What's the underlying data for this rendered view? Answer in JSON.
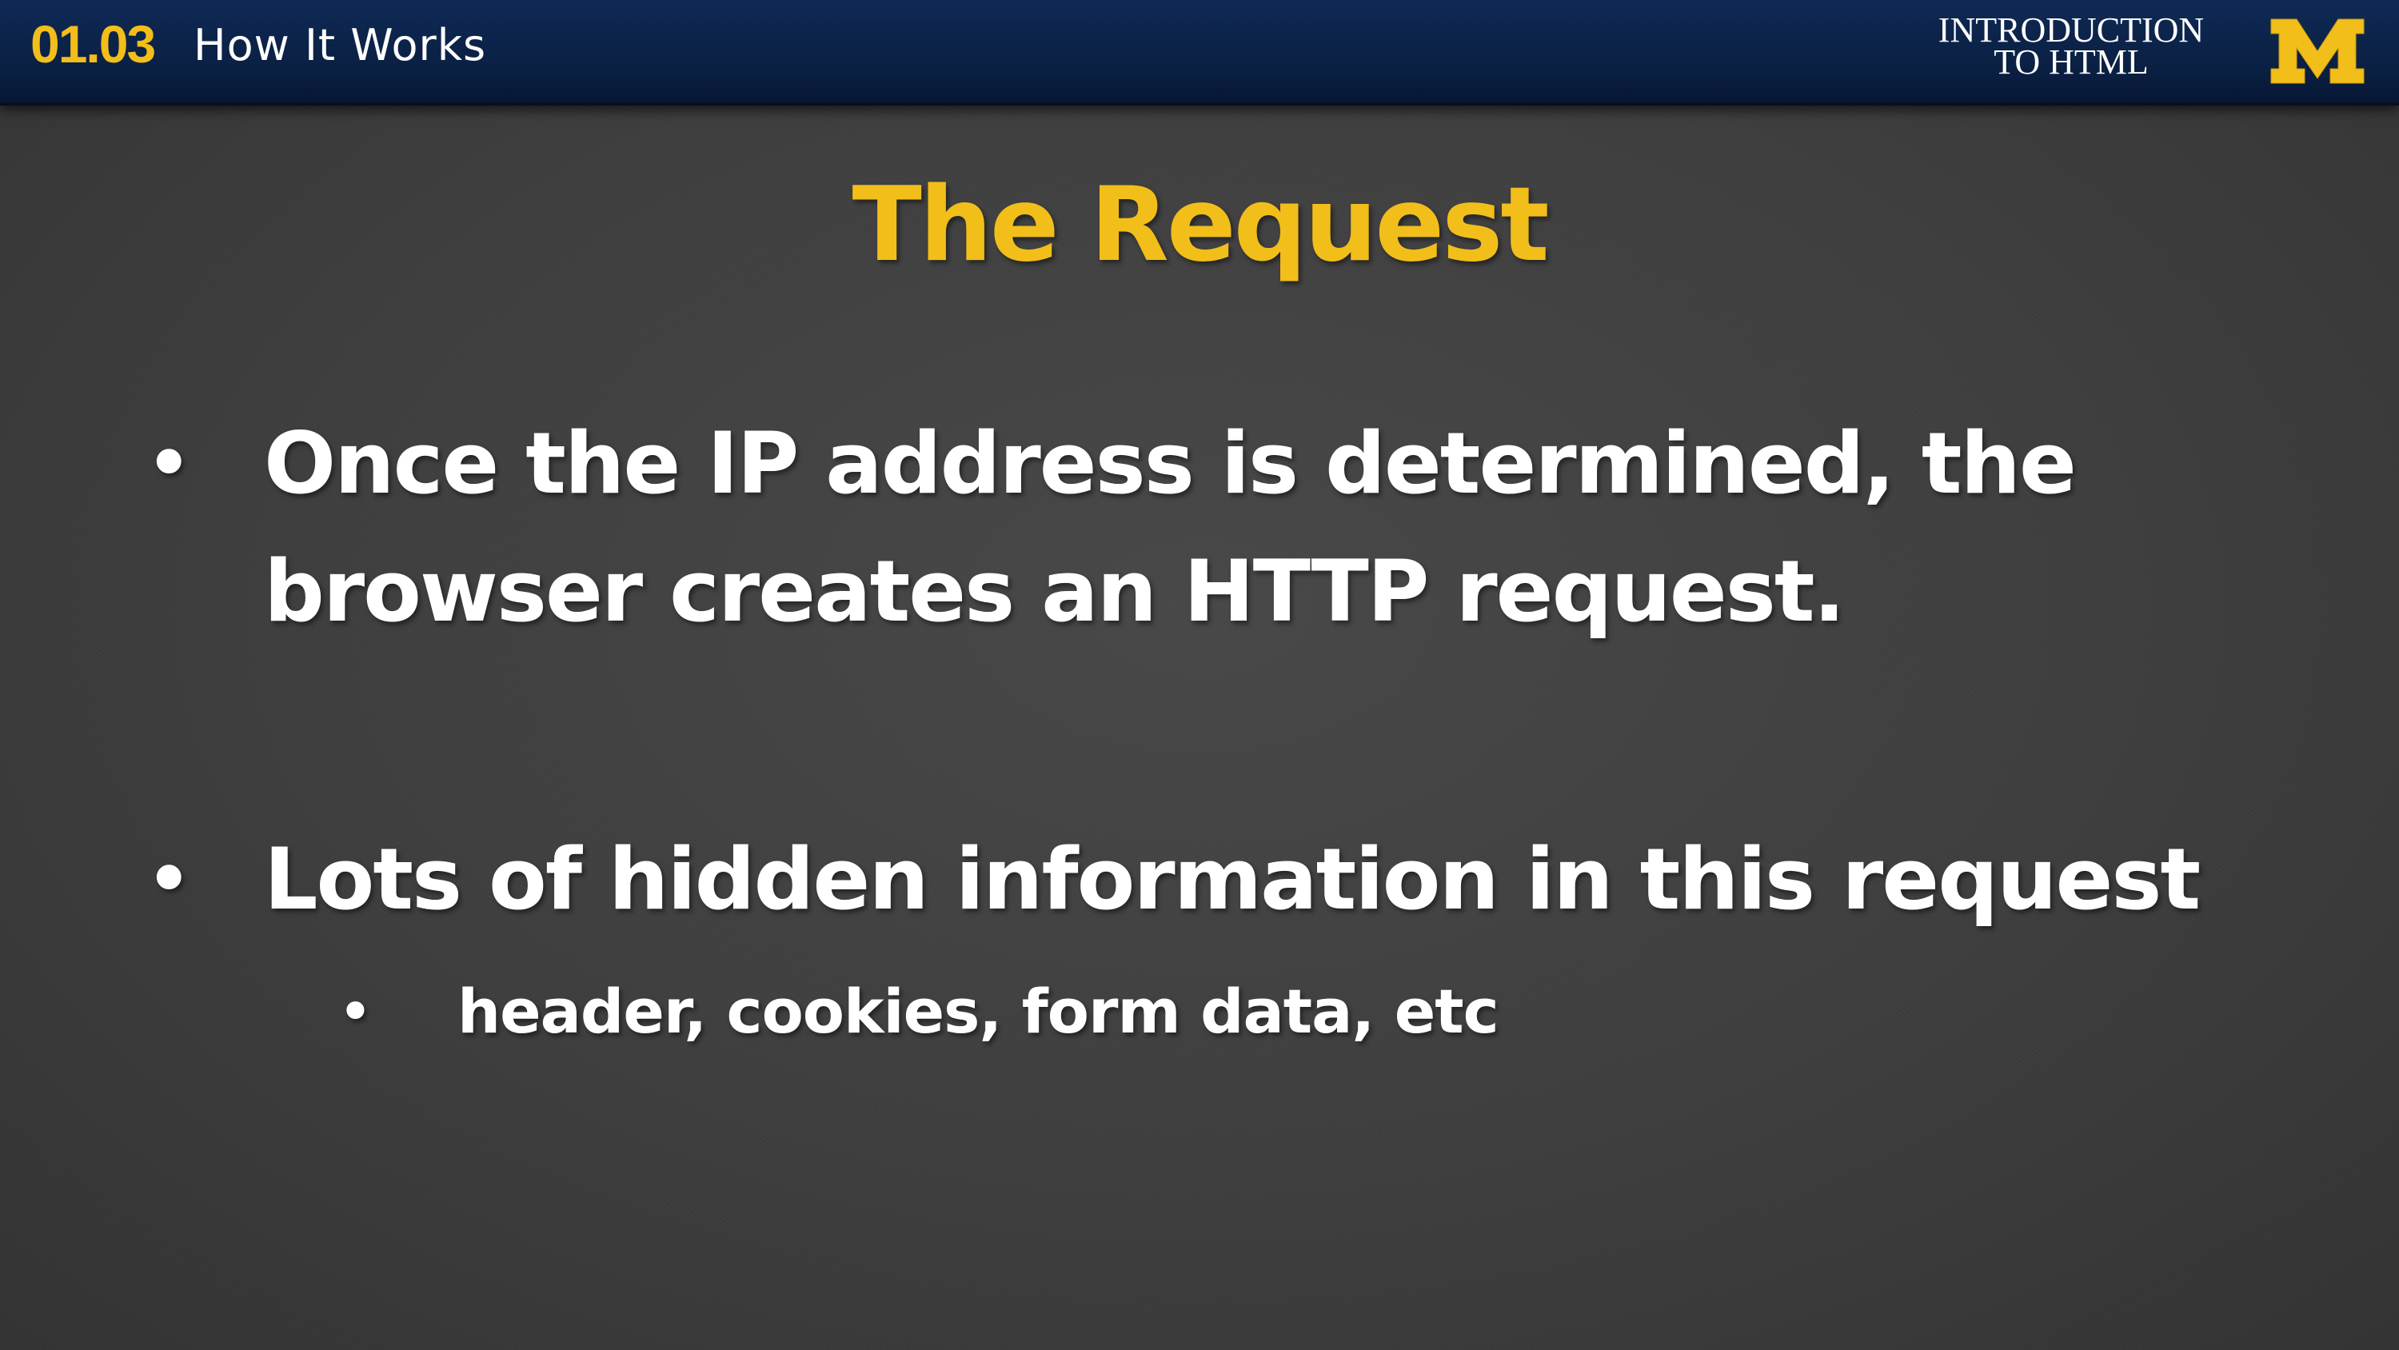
{
  "header": {
    "course_number": "01.03",
    "section_title": "How It Works",
    "course_name": "INTRODUCTION\nTO HTML",
    "logo": "M"
  },
  "slide": {
    "title": "The Request",
    "bullets": [
      {
        "text": "Once the IP address is determined, the browser creates an HTTP request."
      },
      {
        "text": "Lots of hidden information in this request"
      }
    ],
    "sub_bullets": [
      {
        "text": "header, cookies, form data, etc"
      }
    ],
    "bullet_glyph": "•"
  },
  "colors": {
    "accent": "#f2be1a",
    "header_bg": "#0a1f42",
    "background": "#3f3f3f",
    "text": "#ffffff"
  }
}
